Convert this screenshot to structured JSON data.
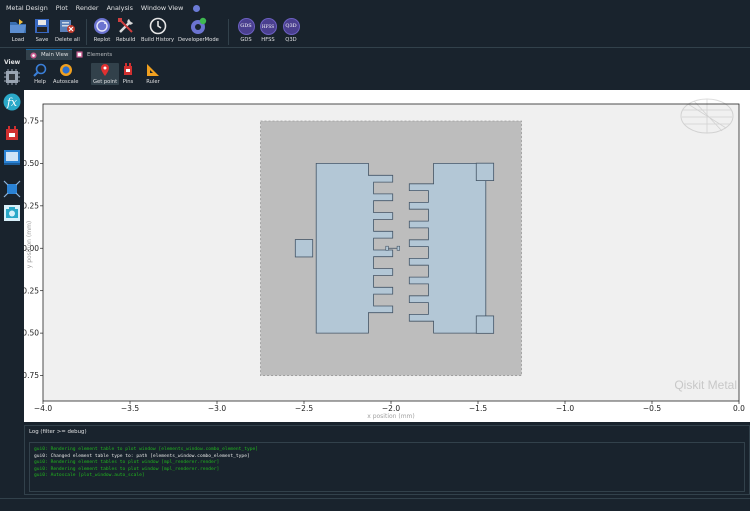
{
  "menu": [
    "Metal Design",
    "Plot",
    "Render",
    "Analysis",
    "Window View"
  ],
  "toolbar": {
    "load": "Load",
    "save": "Save",
    "delete_all": "Delete all",
    "replot": "Replot",
    "rebuild": "Rebuild",
    "build_history": "Build History",
    "developer_mode": "DeveloperMode",
    "gds": "GDS",
    "hfss": "HFSS",
    "q3d": "Q3D",
    "gds_badge": "GDS",
    "hfss_badge": "HFSS",
    "q3d_badge": "Q3D"
  },
  "left_panel": {
    "label": "View"
  },
  "tabs": [
    {
      "label": "Main View"
    },
    {
      "label": "Elements"
    }
  ],
  "plot_tools": {
    "help": "Help",
    "autoscale": "Autoscale",
    "get_point": "Get point",
    "pins": "Pins",
    "ruler": "Ruler"
  },
  "plot": {
    "watermark": "Qiskit Metal"
  },
  "chart_data": {
    "type": "scatter",
    "xlabel": "x position (mm)",
    "ylabel": "y position (mm)",
    "xlim": [
      -4.0,
      0.0
    ],
    "ylim": [
      -0.9,
      0.85
    ],
    "xticks": [
      "−4.0",
      "−3.5",
      "−3.0",
      "−2.5",
      "−2.0",
      "−1.5",
      "−1.0",
      "−0.5",
      "0.0"
    ],
    "yticks": [
      "0.75",
      "0.50",
      "0.25",
      "0.00",
      "−0.25",
      "−0.50",
      "−0.75"
    ],
    "xtick_values": [
      -4.0,
      -3.5,
      -3.0,
      -2.5,
      -2.0,
      -1.5,
      -1.0,
      -0.5,
      0.0
    ],
    "ytick_values": [
      0.75,
      0.5,
      0.25,
      0.0,
      -0.25,
      -0.5,
      -0.75
    ],
    "colors": {
      "ground": "#bdbdbd",
      "metal": "#b3c7d6",
      "edge": "#445566"
    }
  },
  "log": {
    "header": "Log  (filter >= debug)",
    "lines": [
      {
        "text": "gui0: Rendering element table to plot window  [elements_window.combo_element_type]",
        "color": "green"
      },
      {
        "text": "gui0: Changed element table type to: path [elements_window.combo_element_type]",
        "color": "white"
      },
      {
        "text": "gui0: Rendering element tables to plot window  [mpl_renderer.render]",
        "color": "green"
      },
      {
        "text": "gui0: Rendering element tables to plot window  [mpl_renderer.render]",
        "color": "green"
      },
      {
        "text": "gui0: Autoscale [plot_window.auto_scale]",
        "color": "green"
      }
    ]
  }
}
